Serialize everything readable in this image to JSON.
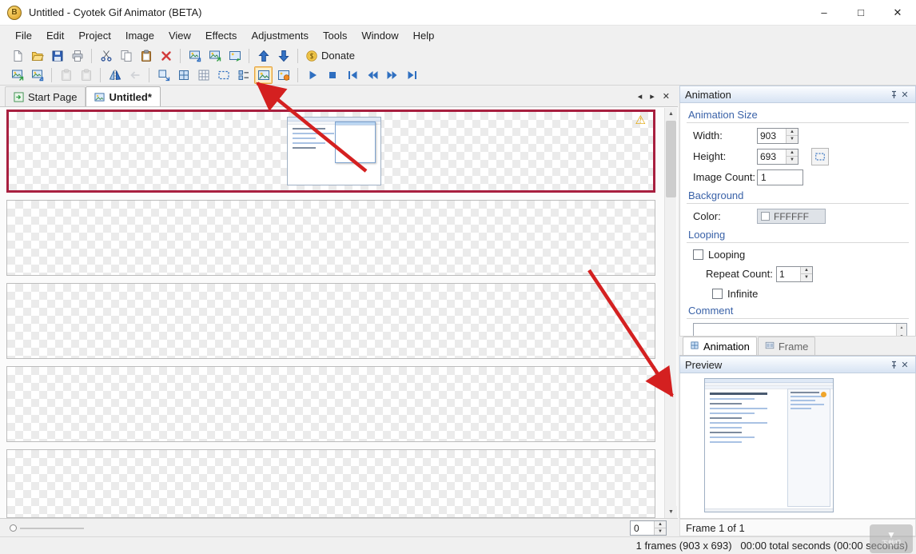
{
  "window": {
    "title": "Untitled - Cyotek Gif Animator (BETA)",
    "minimize": "–",
    "maximize": "□",
    "close": "✕"
  },
  "menu": [
    "File",
    "Edit",
    "Project",
    "Image",
    "View",
    "Effects",
    "Adjustments",
    "Tools",
    "Window",
    "Help"
  ],
  "toolbar_main": {
    "buttons": [
      {
        "name": "new-file",
        "icon": "new-file"
      },
      {
        "name": "open-file",
        "icon": "open-file"
      },
      {
        "name": "save",
        "icon": "save"
      },
      {
        "name": "print",
        "icon": "print"
      },
      {
        "sep": true
      },
      {
        "name": "cut",
        "icon": "cut"
      },
      {
        "name": "copy",
        "icon": "copy"
      },
      {
        "name": "paste",
        "icon": "paste"
      },
      {
        "name": "delete",
        "icon": "delete"
      },
      {
        "sep": true
      },
      {
        "name": "add-frames",
        "icon": "image-import"
      },
      {
        "name": "extract-frames",
        "icon": "image-export"
      },
      {
        "name": "export-animation",
        "icon": "image-arrow"
      },
      {
        "sep": true
      },
      {
        "name": "move-frame-up",
        "icon": "move-up"
      },
      {
        "name": "move-frame-down",
        "icon": "move-down"
      },
      {
        "sep": true
      },
      {
        "name": "donate",
        "icon": "donate",
        "label": "Donate"
      }
    ]
  },
  "toolbar_frames": {
    "buttons": [
      {
        "name": "copy-frame-image",
        "icon": "image-export"
      },
      {
        "name": "save-frame-image",
        "icon": "image-import"
      },
      {
        "sep": true
      },
      {
        "name": "paste-as-new-frame",
        "icon": "paste-gray",
        "disabled": true
      },
      {
        "name": "paste-replace-frame",
        "icon": "paste-gray",
        "disabled": true
      },
      {
        "sep": true
      },
      {
        "name": "flip-horizontal",
        "icon": "flip-horizontal"
      },
      {
        "name": "shift-frames",
        "icon": "back-arrow",
        "disabled": true
      },
      {
        "sep": true
      },
      {
        "name": "resize-animation",
        "icon": "resize"
      },
      {
        "name": "canvas-size",
        "icon": "canvas-size"
      },
      {
        "name": "toggle-grid",
        "icon": "grid"
      },
      {
        "name": "selection",
        "icon": "selection"
      },
      {
        "name": "frame-list",
        "icon": "frame-list"
      },
      {
        "name": "frame-properties",
        "icon": "image",
        "highlighted": true
      },
      {
        "name": "animated-preview",
        "icon": "image-orange"
      },
      {
        "sep": true
      },
      {
        "name": "play",
        "icon": "play"
      },
      {
        "name": "stop",
        "icon": "stop"
      },
      {
        "name": "first-frame",
        "icon": "first-frame"
      },
      {
        "name": "previous-frame",
        "icon": "previous-frame"
      },
      {
        "name": "next-frame",
        "icon": "next-frame"
      },
      {
        "name": "last-frame",
        "icon": "last-frame"
      }
    ]
  },
  "document_tabs": {
    "tabs": [
      {
        "label": "Start Page"
      },
      {
        "label": "Untitled*",
        "active": true
      }
    ]
  },
  "frames_panel": {
    "index_value": "0"
  },
  "animation_panel": {
    "title": "Animation",
    "size_header": "Animation Size",
    "width_label": "Width:",
    "width_value": "903",
    "height_label": "Height:",
    "height_value": "693",
    "image_count_label": "Image Count:",
    "image_count_value": "1",
    "background_header": "Background",
    "color_label": "Color:",
    "color_value": "FFFFFF",
    "looping_header": "Looping",
    "looping_checkbox_label": "Looping",
    "repeat_count_label": "Repeat Count:",
    "repeat_count_value": "1",
    "infinite_label": "Infinite",
    "comment_header": "Comment",
    "tab_animation": "Animation",
    "tab_frame": "Frame"
  },
  "preview_panel": {
    "title": "Preview",
    "frame_status": "Frame 1 of 1"
  },
  "status_bar": {
    "summary": "1 frames (903 x 693)   00:00 total seconds (00:00 seconds)"
  },
  "watermark": {
    "text": "下载吧"
  },
  "colors": {
    "selected_frame_border": "#a81f3f",
    "annotation_arrow": "#d42020",
    "section_header_text": "#3a62a8",
    "toolbar_highlight": "#e8a33d",
    "background_color_value": "#FFFFFF"
  }
}
